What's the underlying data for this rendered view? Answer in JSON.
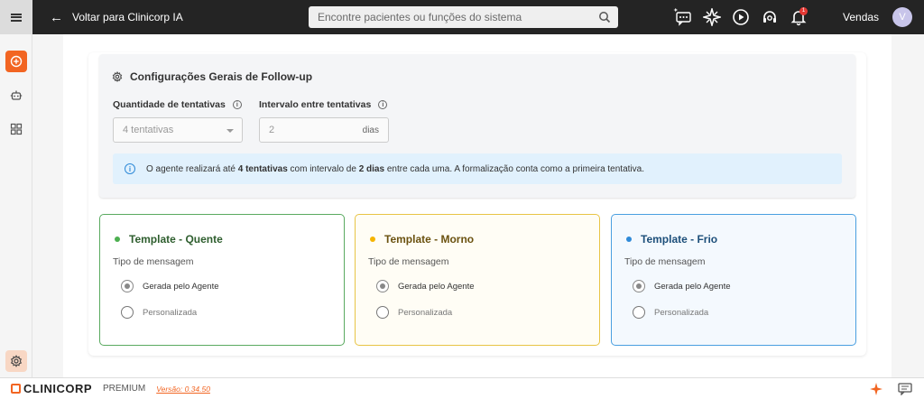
{
  "topbar": {
    "back_label": "Voltar para Clinicorp IA",
    "search_placeholder": "Encontre pacientes ou funções do sistema",
    "notification_count": "1",
    "user_name": "Vendas",
    "avatar_initial": "V"
  },
  "config": {
    "title": "Configurações Gerais de Follow-up",
    "attempts_label": "Quantidade de tentativas",
    "attempts_value": "4 tentativas",
    "interval_label": "Intervalo entre tentativas",
    "interval_value": "2",
    "interval_unit": "dias",
    "info": {
      "pre": "O agente realizará até ",
      "attempts_bold": "4 tentativas",
      "mid": " com intervalo de ",
      "days_bold": "2 dias",
      "post": " entre cada uma. A formalização conta como a primeira tentativa."
    }
  },
  "templates": [
    {
      "title": "Template - Quente",
      "color": "#4caf50",
      "title_color": "#2e5e2e",
      "type_label": "Tipo de mensagem",
      "option_agent": "Gerada pelo Agente",
      "option_custom": "Personalizada",
      "selected": "agent"
    },
    {
      "title": "Template - Morno",
      "color": "#f5b400",
      "title_color": "#6b5210",
      "type_label": "Tipo de mensagem",
      "option_agent": "Gerada pelo Agente",
      "option_custom": "Personalizada",
      "selected": "agent"
    },
    {
      "title": "Template - Frio",
      "color": "#2f8ad8",
      "title_color": "#1d4f7a",
      "type_label": "Tipo de mensagem",
      "option_agent": "Gerada pelo Agente",
      "option_custom": "Personalizada",
      "selected": "agent"
    }
  ],
  "footer": {
    "brand": "CLINICORP",
    "plan": "PREMIUM",
    "version": "Versão: 0.34.50"
  },
  "colors": {
    "accent": "#f26522",
    "topbar": "#242424"
  }
}
